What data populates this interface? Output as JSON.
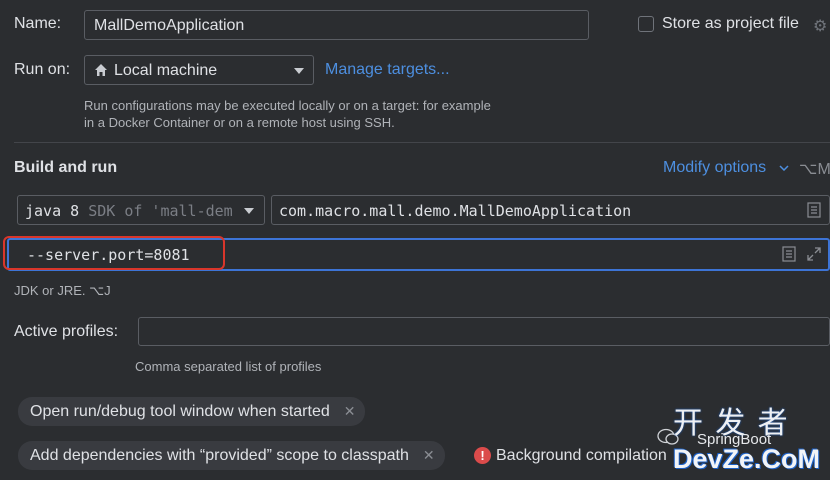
{
  "name": {
    "label": "Name:",
    "value": "MallDemoApplication"
  },
  "store_project_file": {
    "label": "Store as project file",
    "checked": false
  },
  "run_on": {
    "label": "Run on:",
    "value": "Local machine",
    "manage_targets": "Manage targets...",
    "hint_line1": "Run configurations may be executed locally or on a target: for example",
    "hint_line2": "in a Docker Container or on a remote host using SSH."
  },
  "build_and_run": {
    "title": "Build and run",
    "modify_options": "Modify options",
    "modify_shortcut": "⌥M",
    "jdk_name": "java 8",
    "jdk_detail": "SDK of 'mall-dem",
    "main_class": "com.macro.mall.demo.MallDemoApplication",
    "program_args": "--server.port=8081",
    "jdk_hint": "JDK or JRE. ⌥J"
  },
  "active_profiles": {
    "label": "Active profiles:",
    "value": "",
    "hint": "Comma separated list of profiles"
  },
  "chips": [
    {
      "label": "Open run/debug tool window when started"
    },
    {
      "label": "Add dependencies with “provided” scope to classpath"
    }
  ],
  "warning": {
    "text": "Background compilation"
  },
  "watermark": {
    "line1": "SpringBoot",
    "line2": "开 发 者",
    "line3": "DevZe.CoM"
  },
  "colors": {
    "background": "#2b2d30",
    "accent": "#4d8fe0",
    "highlight_box": "#d9362b",
    "error": "#db4b4b"
  }
}
